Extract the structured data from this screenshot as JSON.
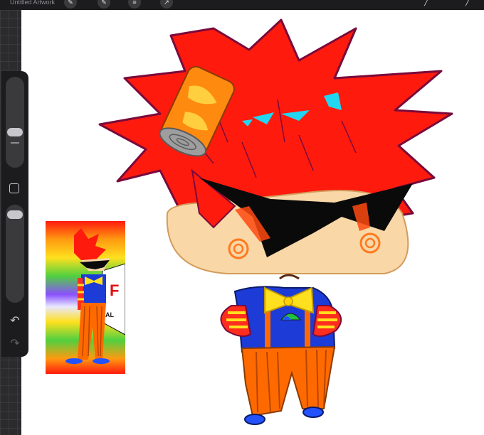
{
  "app": {
    "doc_title": "Untitled Artwork"
  },
  "toolbar": {
    "icons": [
      "brush-icon",
      "smudge-icon",
      "eraser-icon",
      "layers-icon",
      "color-icon"
    ]
  },
  "sidebar": {
    "brush_size_fraction": 0.3,
    "opacity_fraction": 0.1,
    "undo_icon": "undo-arrow",
    "redo_icon": "redo-arrow"
  },
  "colors": {
    "hair": "#ff1a0e",
    "hair_outline": "#7a0a3a",
    "skin": "#f9d7a6",
    "shades": "#0a0a0a",
    "shirt": "#1d3bd6",
    "bowtie": "#ffe01e",
    "pants": "#ff6a00",
    "shoes": "#2352ff",
    "highlight": "#21d6f2",
    "can_orange": "#ff8a10",
    "can_gray": "#9e9e9e",
    "ui_dark": "#1c1c1e"
  }
}
